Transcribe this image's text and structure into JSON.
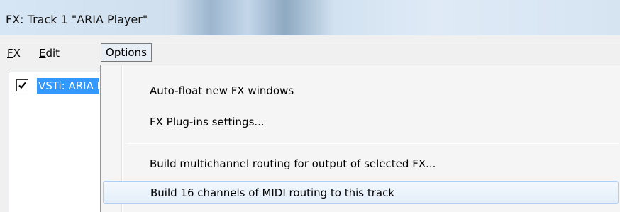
{
  "window": {
    "title": "FX: Track 1 \"ARIA Player\""
  },
  "menubar": {
    "items": [
      {
        "accel": "F",
        "rest": "X"
      },
      {
        "accel": "E",
        "rest": "dit"
      },
      {
        "accel": "O",
        "rest": "ptions"
      }
    ],
    "active": "Options"
  },
  "fx_list": {
    "items": [
      {
        "name": "VSTi: ARIA Player",
        "enabled": true
      }
    ]
  },
  "options_menu": {
    "items": [
      {
        "label": "Auto-float new FX windows"
      },
      {
        "label": "FX Plug-ins settings..."
      },
      {
        "label": "Build multichannel routing for output of selected FX..."
      },
      {
        "label": "Build 16 channels of MIDI routing to this track",
        "highlighted": true
      }
    ]
  }
}
